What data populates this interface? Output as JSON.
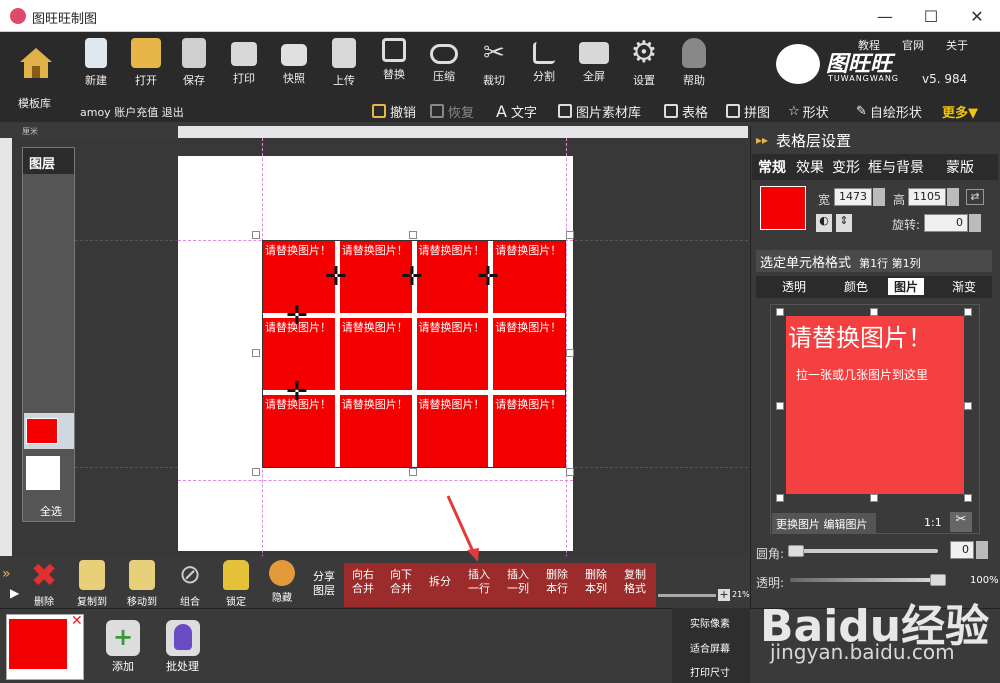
{
  "window": {
    "title": "图旺旺制图",
    "minimize": "—",
    "maximize": "☐",
    "close": "✕"
  },
  "toolbar": {
    "home_label": "模板库",
    "buttons": [
      {
        "id": "new",
        "label": "新建"
      },
      {
        "id": "open",
        "label": "打开"
      },
      {
        "id": "save",
        "label": "保存"
      },
      {
        "id": "print",
        "label": "打印"
      },
      {
        "id": "snapshot",
        "label": "快照"
      },
      {
        "id": "upload",
        "label": "上传"
      },
      {
        "id": "replace",
        "label": "替换"
      },
      {
        "id": "compress",
        "label": "压缩"
      },
      {
        "id": "crop",
        "label": "裁切"
      },
      {
        "id": "split",
        "label": "分割"
      },
      {
        "id": "fullscreen",
        "label": "全屏"
      },
      {
        "id": "settings",
        "label": "设置"
      },
      {
        "id": "help",
        "label": "帮助"
      }
    ],
    "top_links": [
      "教程",
      "官网",
      "关于"
    ],
    "logo_text": "图旺旺",
    "logo_sub": "TUWANGWANG",
    "version": "v5. 984",
    "account": {
      "user": "amoy",
      "recharge": "账户充值",
      "logout": "退出"
    },
    "row2": {
      "undo": "撤销",
      "redo": "恢复",
      "text": "文字",
      "image_lib": "图片素材库",
      "table": "表格",
      "collage": "拼图",
      "shape": "形状",
      "custom_shape": "自绘形状",
      "more": "更多▼"
    }
  },
  "ruler": {
    "unit": "厘米"
  },
  "canvas": {
    "cell_text": "请替换图片！",
    "rows": 3,
    "cols": 4
  },
  "layers": {
    "title": "图层",
    "select_all": "全选"
  },
  "bottom_toolbar": {
    "buttons": [
      {
        "id": "delete",
        "label": "删除"
      },
      {
        "id": "copy_to",
        "label": "复制到"
      },
      {
        "id": "move_to",
        "label": "移动到"
      },
      {
        "id": "group",
        "label": "组合"
      },
      {
        "id": "lock",
        "label": "锁定"
      },
      {
        "id": "hide",
        "label": "隐藏"
      }
    ],
    "share_layer": "分享图层",
    "table_ops": [
      {
        "l1": "向右",
        "l2": "合并"
      },
      {
        "l1": "向下",
        "l2": "合并"
      },
      {
        "l1": "拆分",
        "l2": ""
      },
      {
        "l1": "插入",
        "l2": "一行"
      },
      {
        "l1": "插入",
        "l2": "一列"
      },
      {
        "l1": "删除",
        "l2": "本行"
      },
      {
        "l1": "删除",
        "l2": "本列"
      },
      {
        "l1": "复制",
        "l2": "格式"
      }
    ],
    "zoom": "21%"
  },
  "right_panel": {
    "title": "表格层设置",
    "tabs": [
      "常规",
      "效果",
      "变形",
      "框与背景",
      "蒙版"
    ],
    "width_label": "宽",
    "width_value": "1473",
    "height_label": "高",
    "height_value": "1105",
    "rotate_label": "旋转:",
    "rotate_value": "0",
    "cell_format_label": "选定单元格格式",
    "cell_pos": "第1行 第1列",
    "subtabs": [
      "透明",
      "颜色",
      "图片",
      "渐变"
    ],
    "preview_big": "请替换图片！",
    "preview_small": "拉一张或几张图片到这里",
    "change_image": "更换图片",
    "edit_image": "编辑图片",
    "ratio": "1:1",
    "corner_label": "圆角:",
    "corner_value": "0",
    "opacity_label": "透明:",
    "opacity_value": "100%"
  },
  "bottom_strip": {
    "add_label": "添加",
    "batch_label": "批处理",
    "options": [
      "实际像素",
      "适合屏幕",
      "打印尺寸"
    ]
  },
  "watermark": {
    "main": "Baidu经验",
    "url": "jingyan.baidu.com"
  },
  "colors": {
    "cell_red": "#f40000",
    "accent_yellow": "#f1c40f",
    "toolbar_bg": "#2a2a2a"
  }
}
